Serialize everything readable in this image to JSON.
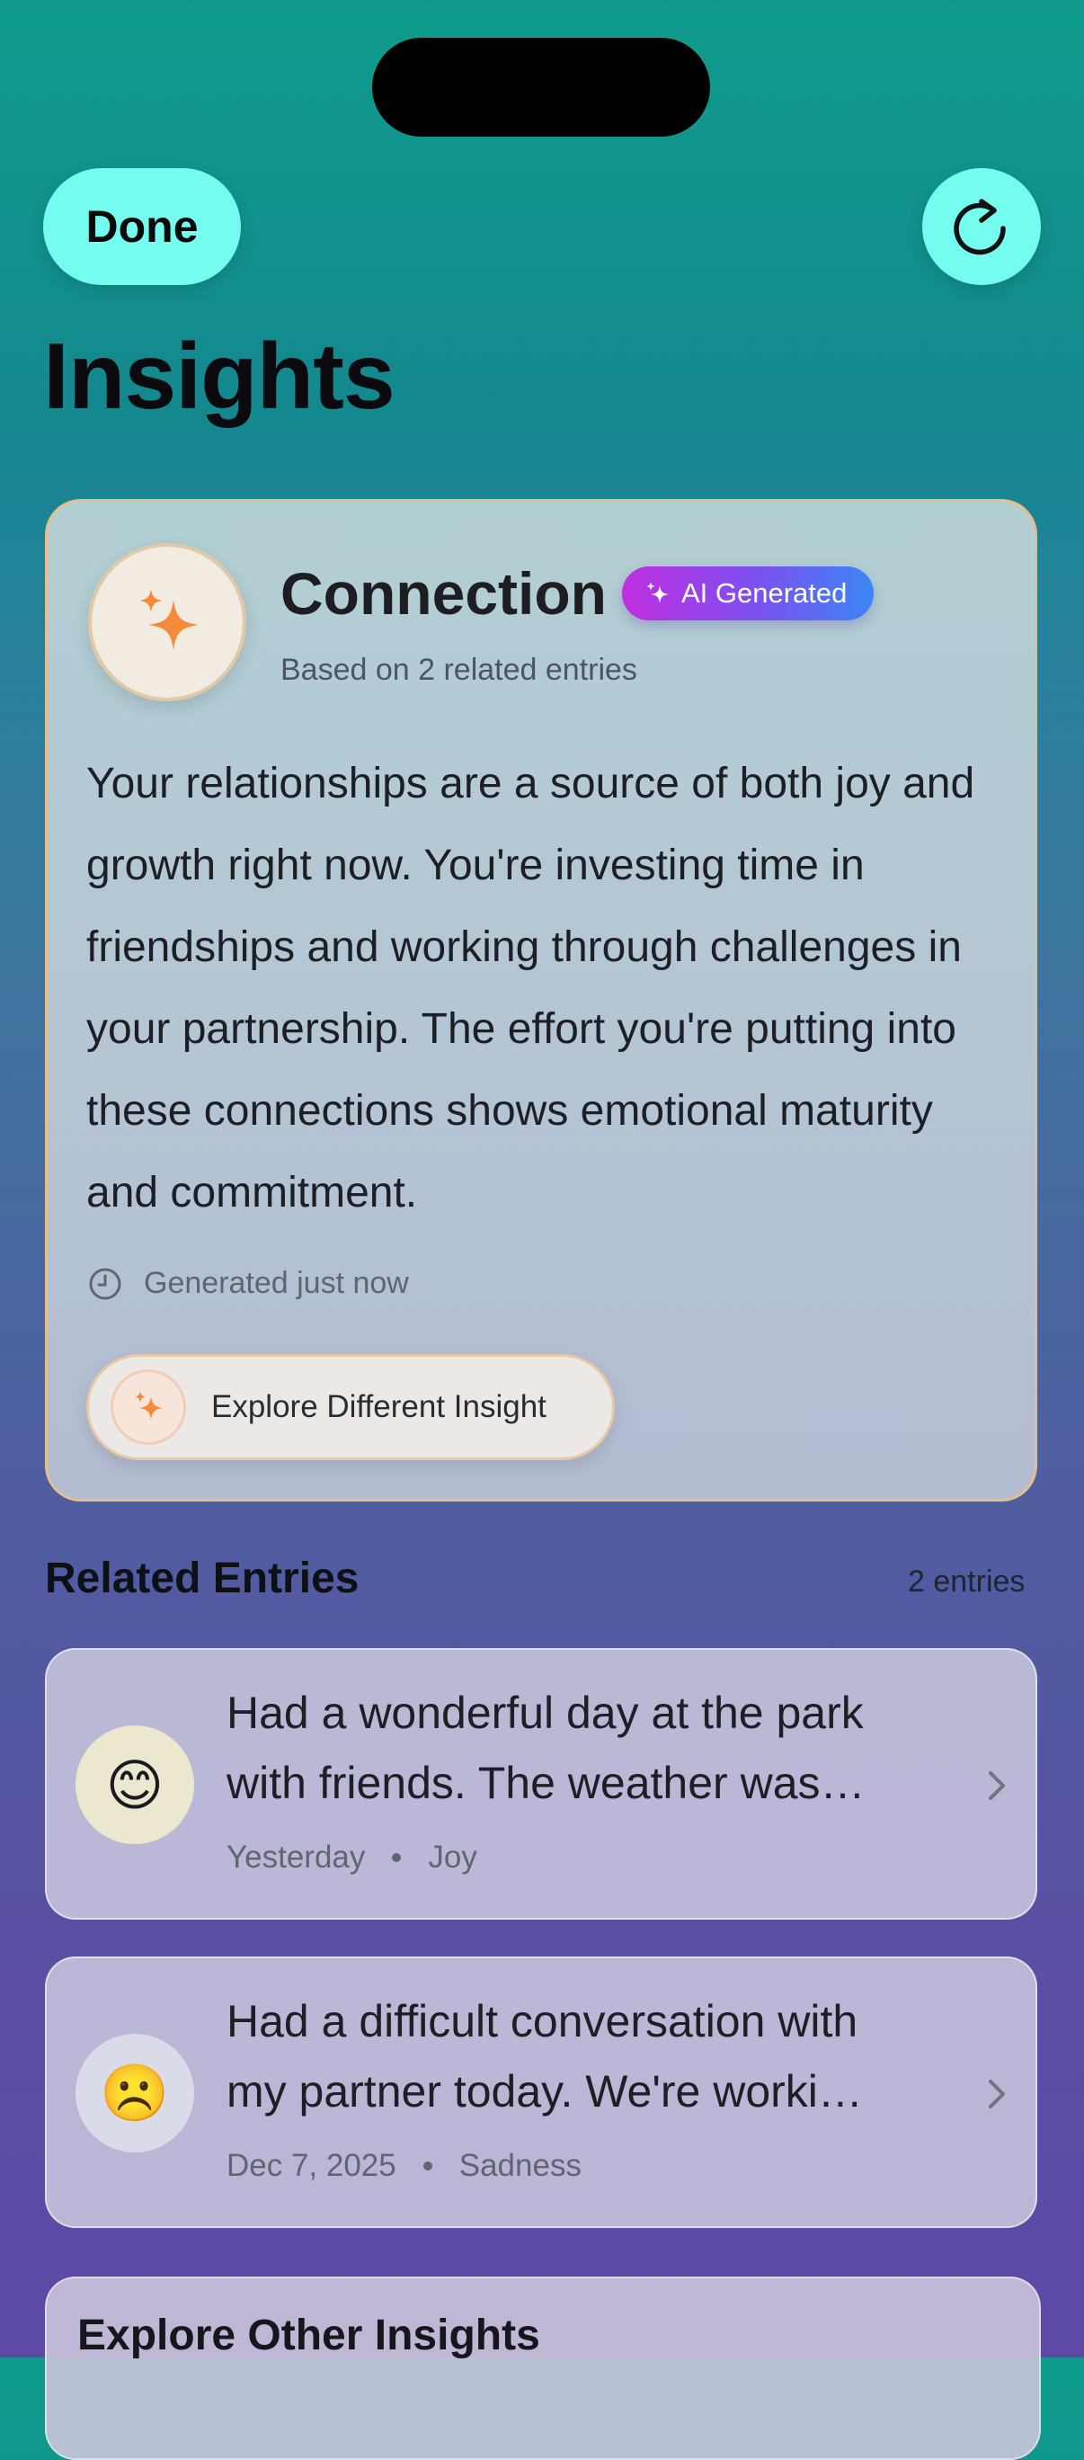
{
  "nav": {
    "done_label": "Done",
    "refresh_icon": "refresh-icon"
  },
  "page_title": "Insights",
  "insight": {
    "title": "Connection",
    "badge": "AI Generated",
    "subtitle": "Based on 2 related entries",
    "body": "Your relationships are a source of both joy and growth right now. You're investing time in friendships and working through challenges in your partnership. The effort you're putting into these connections shows emotional maturity and commitment.",
    "generated": "Generated just now",
    "explore_label": "Explore Different Insight",
    "accent_color": "#f58a3a"
  },
  "related": {
    "title": "Related Entries",
    "count": "2 entries",
    "entries": [
      {
        "emoji": "😊",
        "text": "Had a wonderful day at the park with friends. The weather was…",
        "date": "Yesterday",
        "mood": "Joy"
      },
      {
        "emoji": "☹️",
        "text": "Had a difficult conversation with my partner today. We're worki…",
        "date": "Dec 7, 2025",
        "mood": "Sadness"
      }
    ]
  },
  "explore_other": {
    "title": "Explore Other Insights"
  }
}
